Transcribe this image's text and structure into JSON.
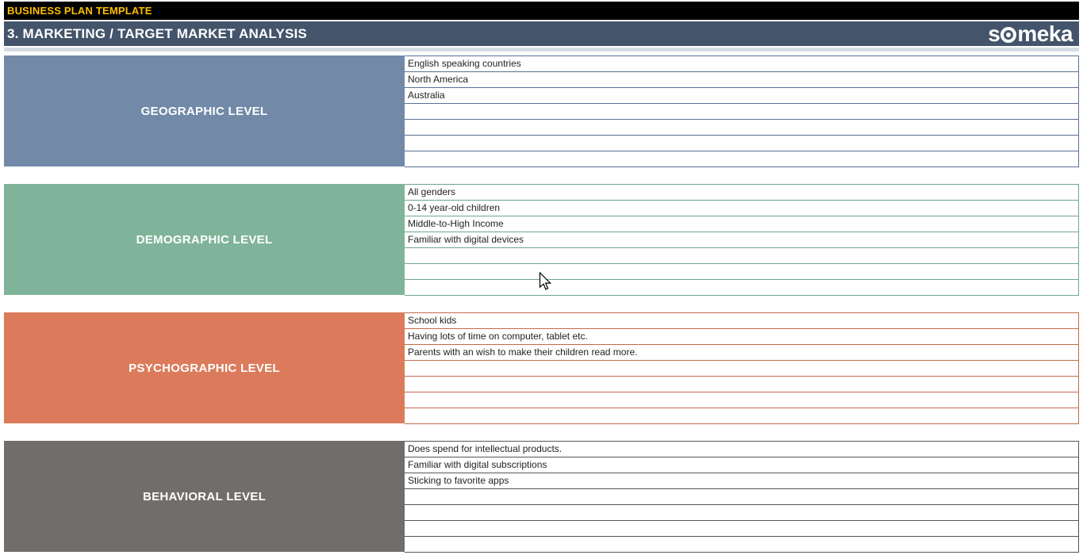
{
  "title_bar": {
    "label": "BUSINESS PLAN TEMPLATE"
  },
  "header": {
    "title": "3. MARKETING / TARGET MARKET ANALYSIS",
    "logo": {
      "pre": "s",
      "post": "meka"
    }
  },
  "colors": {
    "title_bar_bg": "#000000",
    "title_bar_text": "#FFC000",
    "header_bg": "#44546A",
    "header_text": "#FFFFFF",
    "divider_strip": "#D6DCE4",
    "row_bg": "#FFFFFF",
    "row_text": "#1F1F1F"
  },
  "sections": [
    {
      "label": "GEOGRAPHIC LEVEL",
      "color": "#7289A8",
      "border_color": "#5A7094",
      "rows": [
        "English speaking countries",
        "North America",
        "Australia",
        "",
        "",
        "",
        ""
      ]
    },
    {
      "label": "DEMOGRAPHIC LEVEL",
      "color": "#7FB49A",
      "border_color": "#6EA68C",
      "rows": [
        "All genders",
        "0-14 year-old children",
        "Middle-to-High Income",
        "Familiar with digital devices",
        "",
        "",
        ""
      ]
    },
    {
      "label": "PSYCHOGRAPHIC LEVEL",
      "color": "#DC7B5C",
      "border_color": "#C66A4D",
      "rows": [
        "School kids",
        "Having lots of time on computer, tablet etc.",
        "Parents with an wish to make their children read more.",
        "",
        "",
        "",
        ""
      ]
    },
    {
      "label": "BEHAVIORAL LEVEL",
      "color": "#706D6B",
      "border_color": "#585654",
      "rows": [
        "Does spend for intellectual products.",
        "Familiar with digital subscriptions",
        "Sticking to favorite apps",
        "",
        "",
        "",
        ""
      ]
    }
  ]
}
